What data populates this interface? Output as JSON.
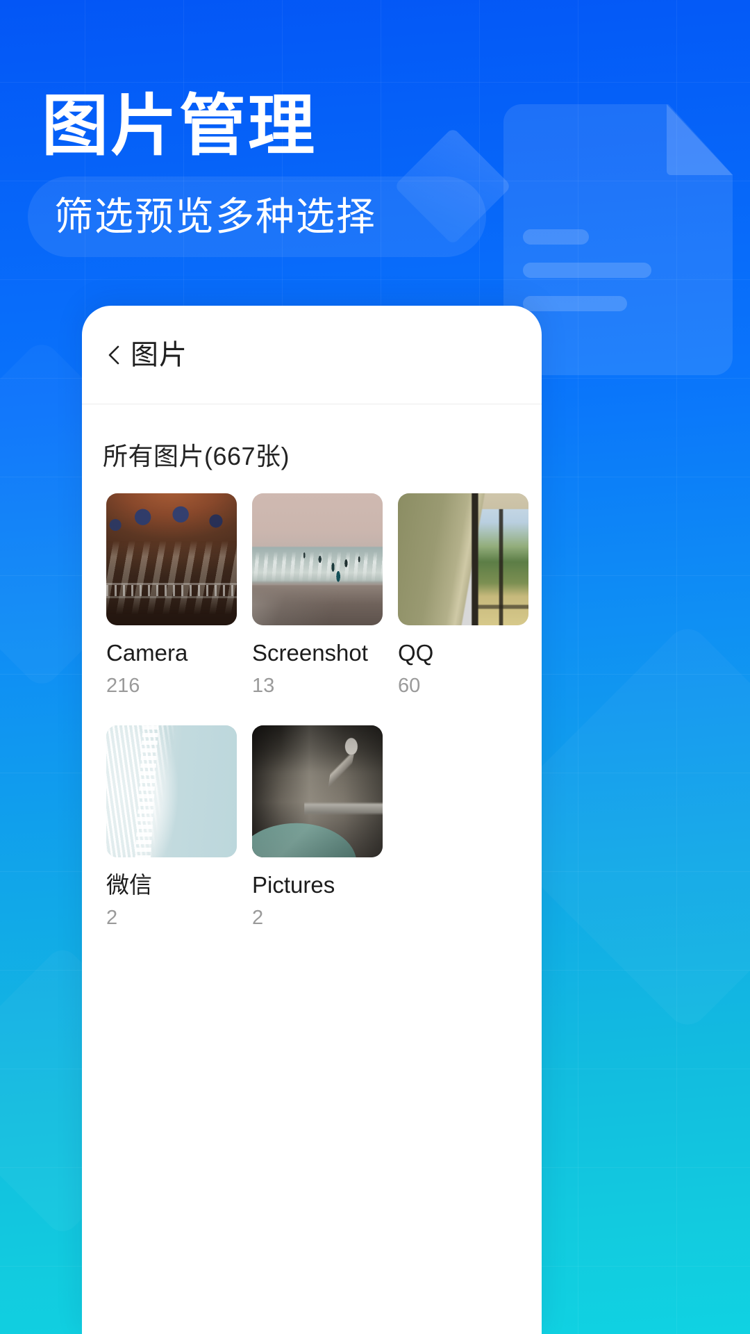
{
  "hero": {
    "title": "图片管理",
    "subtitle": "筛选预览多种选择"
  },
  "colors": {
    "brand_blue": "#0560F8",
    "gradient_end_cyan": "#10D2E2",
    "card_white": "#FFFFFF",
    "text_primary": "#1C1C1C",
    "text_secondary": "#9A9A9A",
    "divider": "#ECECEC"
  },
  "phone": {
    "nav": {
      "back_icon": "chevron-left-icon",
      "title": "图片"
    },
    "section": {
      "label": "所有图片(667张)",
      "total_count": 667
    },
    "albums": [
      {
        "name": "Camera",
        "count": "216",
        "thumb": "dome-interior-photo"
      },
      {
        "name": "Screenshot",
        "count": "13",
        "thumb": "beach-dusk-photo"
      },
      {
        "name": "QQ",
        "count": "60",
        "thumb": "window-interior-photo"
      },
      {
        "name": "微信",
        "count": "2",
        "thumb": "aerial-surf-photo"
      },
      {
        "name": "Pictures",
        "count": "2",
        "thumb": "scooter-mirror-photo"
      }
    ]
  },
  "decor": {
    "document_icon": "document-illustration",
    "diamond_icon": "diamond-shape-icon"
  }
}
